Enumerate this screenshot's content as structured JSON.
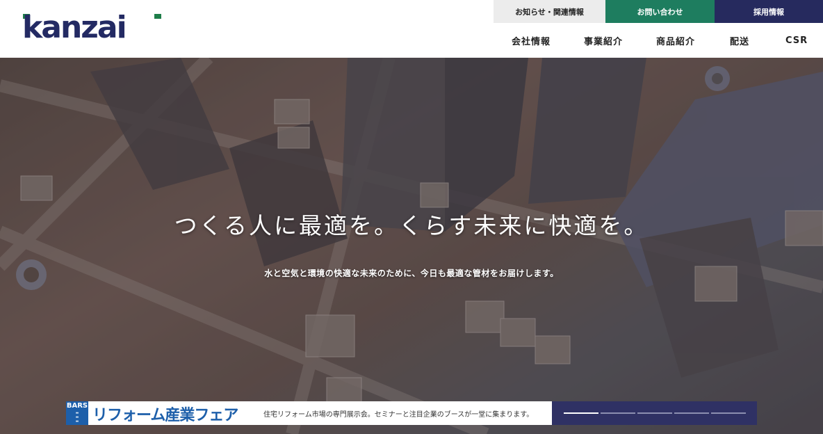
{
  "logo": {
    "text": "kanzai",
    "accent": "#1e7d49",
    "color": "#232a63"
  },
  "top_links": {
    "news": "お知らせ・関連情報",
    "contact": "お問い合わせ",
    "recruit": "採用情報"
  },
  "nav": {
    "company": "会社情報",
    "business": "事業紹介",
    "products": "商品紹介",
    "delivery": "配送",
    "csr": "CSR"
  },
  "hero": {
    "copy": "つくる人に最適を。くらす未来に快適を。",
    "subcopy": "水と空気と環境の快適な未来のために、今日も最適な管材をお届けします。"
  },
  "banner": {
    "badge": "BARS",
    "title": "リフォーム産業フェア",
    "description": "住宅リフォーム市場の専門展示会。セミナーと注目企業のブースが一堂に集まります。",
    "slides": 5,
    "active_slide": 1
  },
  "colors": {
    "contact_bg": "#1e7d5f",
    "recruit_bg": "#262a5e",
    "news_bg": "#ececec",
    "banner_indicator_bg": "#2f3164",
    "fair_blue": "#1d5faa"
  }
}
